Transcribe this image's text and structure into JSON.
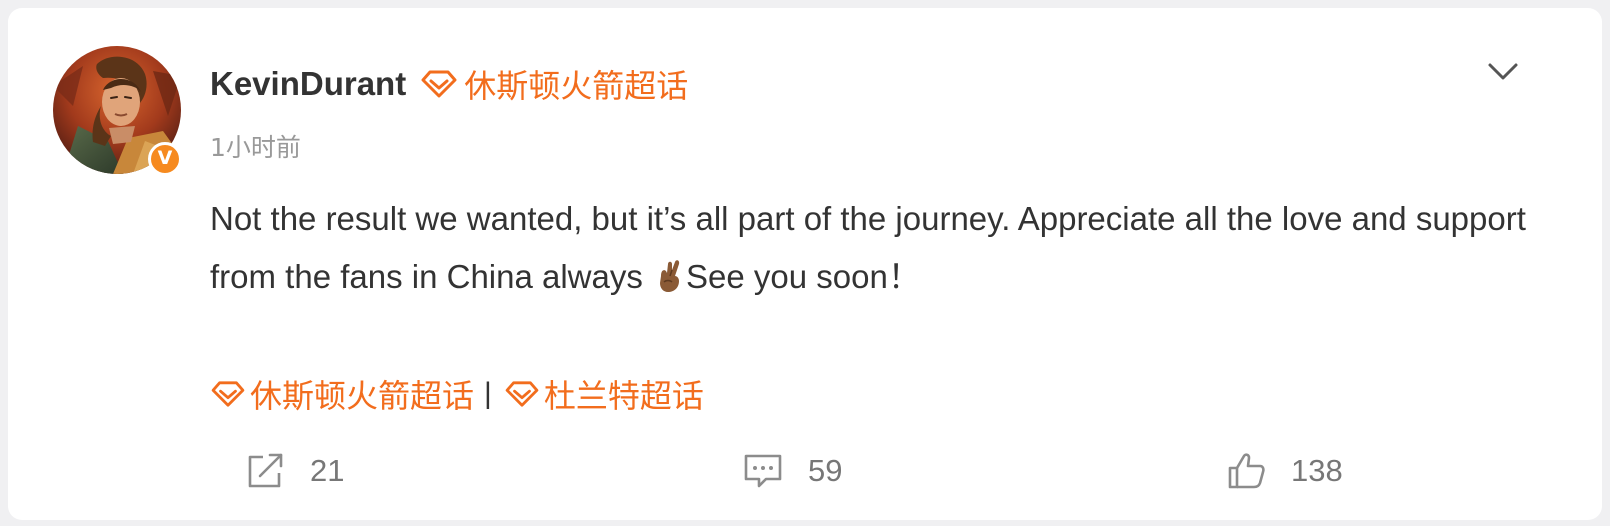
{
  "post": {
    "username": "KevinDurant",
    "supertopic": "休斯顿火箭超话",
    "timestamp": "1小时前",
    "text_part1": "Not the result we wanted, but it’s all part of the journey. Appreciate all the love and support from the fans in China always ",
    "emoji": "crossed-fingers-emoji",
    "text_part2": "See you soon！",
    "verified_badge": "V"
  },
  "topics": {
    "items": [
      "休斯顿火箭超话",
      "杜兰特超话"
    ],
    "separator": "|"
  },
  "actions": {
    "share_count": "21",
    "comment_count": "59",
    "like_count": "138"
  },
  "colors": {
    "accent": "#f26d1d",
    "verified": "#f68a1f",
    "text": "#333333",
    "muted": "#999999"
  },
  "icons": [
    "supertopic-diamond-icon",
    "chevron-down-icon",
    "share-icon",
    "comment-icon",
    "like-icon"
  ]
}
